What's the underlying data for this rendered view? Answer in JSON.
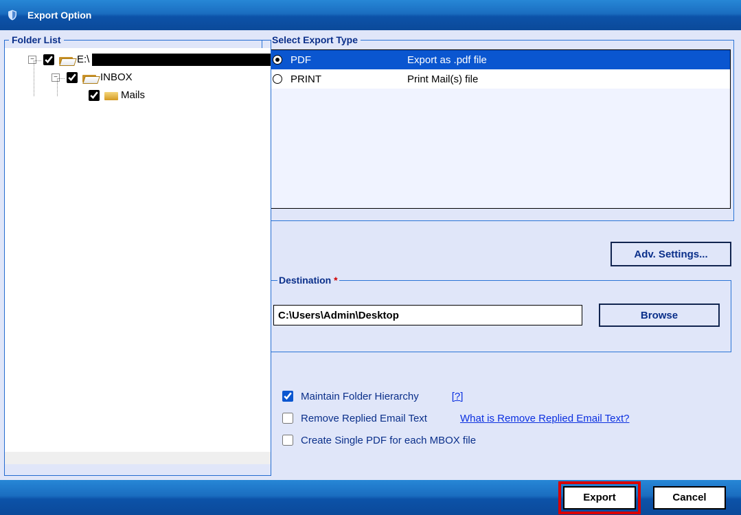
{
  "title": "Export Option",
  "folder_list": {
    "legend": "Folder List",
    "root": {
      "label_prefix": "E:\\",
      "checked": true,
      "children": [
        {
          "label": "INBOX",
          "checked": true,
          "children": [
            {
              "label": "Mails",
              "checked": true
            }
          ]
        }
      ]
    }
  },
  "export_type": {
    "legend": "Select Export Type",
    "rows": [
      {
        "code": "PDF",
        "desc": "Export as .pdf file",
        "selected": true
      },
      {
        "code": "PRINT",
        "desc": "Print Mail(s) file",
        "selected": false
      }
    ]
  },
  "adv_settings_label": "Adv. Settings...",
  "destination": {
    "legend": "Destination",
    "required_mark": "*",
    "path": "C:\\Users\\Admin\\Desktop",
    "browse_label": "Browse"
  },
  "options": {
    "maintain": {
      "label": "Maintain Folder Hierarchy",
      "checked": true,
      "hint": "[?]"
    },
    "remove_replied": {
      "label": "Remove Replied Email Text",
      "checked": false,
      "hint": "What is Remove Replied Email Text?"
    },
    "single_pdf": {
      "label": "Create Single PDF for each MBOX file",
      "checked": false
    }
  },
  "buttons": {
    "export": "Export",
    "cancel": "Cancel"
  }
}
